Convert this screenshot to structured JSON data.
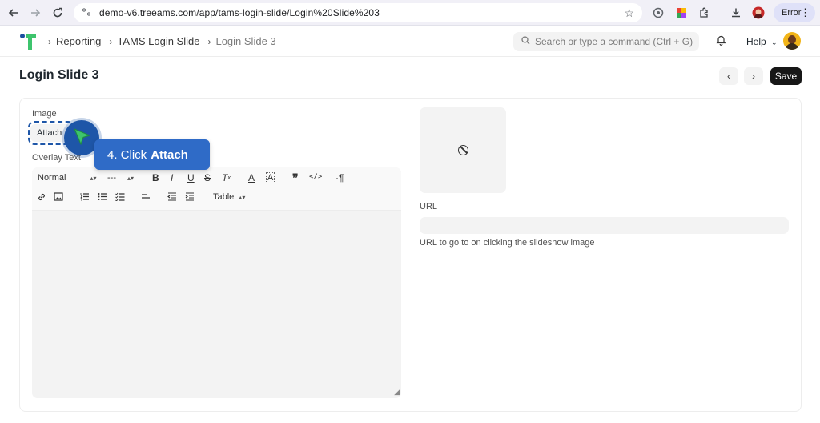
{
  "browser": {
    "url": "demo-v6.treeams.com/app/tams-login-slide/Login%20Slide%203",
    "profile_status": "Error"
  },
  "header": {
    "breadcrumbs": [
      "Reporting",
      "TAMS Login Slide",
      "Login Slide 3"
    ],
    "search_placeholder": "Search or type a command (Ctrl + G)",
    "help_label": "Help"
  },
  "page": {
    "title": "Login Slide 3",
    "save_label": "Save"
  },
  "form": {
    "image_label": "Image",
    "attach_label": "Attach",
    "overlay_text_label": "Overlay Text",
    "editor_toolbar": {
      "format_select": "Normal",
      "size_select": "---",
      "table_select": "Table"
    },
    "url_label": "URL",
    "url_value": "",
    "url_help": "URL to go to on clicking the slideshow image"
  },
  "tutorial": {
    "step_prefix": "4. Click",
    "step_target": "Attach"
  },
  "colors": {
    "accent_blue": "#1e56a8",
    "tooltip_blue": "#2f6bc7",
    "save_button": "#171717",
    "logo_green": "#3ec46d",
    "logo_blue": "#1a4fa0"
  },
  "icons": [
    "back-icon",
    "forward-icon",
    "reload-icon",
    "site-settings-icon",
    "star-icon",
    "extension-icon",
    "download-icon",
    "bell-icon",
    "search-icon",
    "chevron-left-icon",
    "chevron-right-icon",
    "no-image-icon",
    "cursor-arrow-icon"
  ]
}
